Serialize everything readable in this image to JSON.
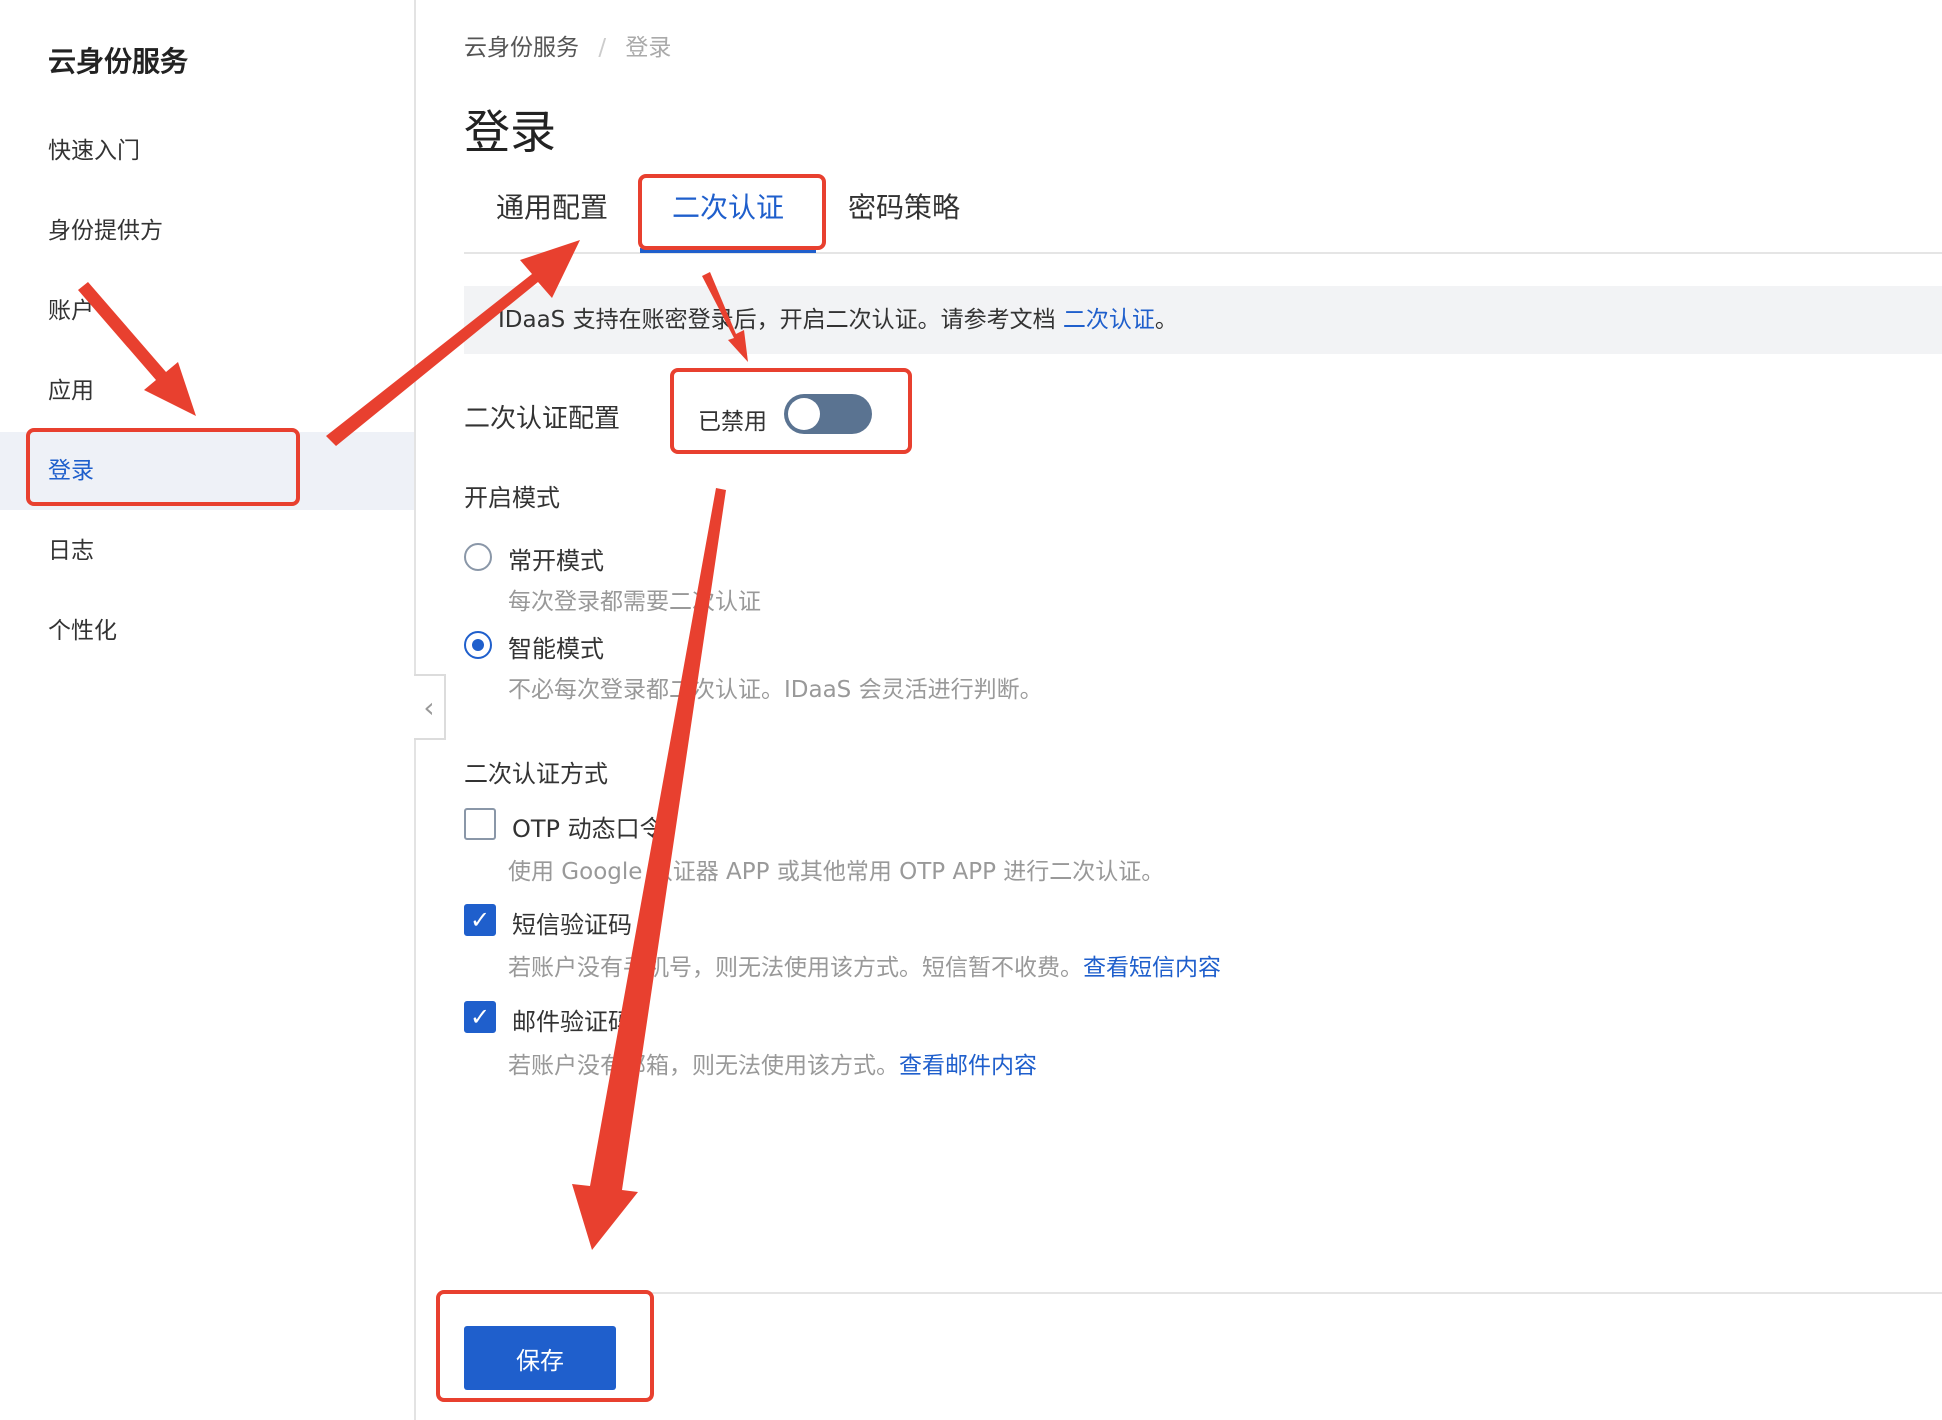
{
  "sidebar": {
    "title": "云身份服务",
    "items": [
      {
        "label": "快速入门"
      },
      {
        "label": "身份提供方"
      },
      {
        "label": "账户"
      },
      {
        "label": "应用"
      },
      {
        "label": "登录"
      },
      {
        "label": "日志"
      },
      {
        "label": "个性化"
      }
    ]
  },
  "breadcrumb": {
    "root": "云身份服务",
    "separator": "/",
    "current": "登录"
  },
  "page_title": "登录",
  "tabs": [
    {
      "label": "通用配置"
    },
    {
      "label": "二次认证"
    },
    {
      "label": "密码策略"
    }
  ],
  "notice": {
    "text": "IDaaS 支持在账密登录后，开启二次认证。请参考文档 ",
    "link": "二次认证",
    "end": "。"
  },
  "mfa_config": {
    "label": "二次认证配置",
    "status": "已禁用"
  },
  "mode": {
    "title": "开启模式",
    "options": [
      {
        "label": "常开模式",
        "desc": "每次登录都需要二次认证"
      },
      {
        "label": "智能模式",
        "desc": "不必每次登录都二次认证。IDaaS 会灵活进行判断。"
      }
    ]
  },
  "methods": {
    "title": "二次认证方式",
    "options": [
      {
        "label": "OTP 动态口令",
        "desc": "使用 Google 认证器 APP 或其他常用 OTP APP 进行二次认证。",
        "link": ""
      },
      {
        "label": "短信验证码",
        "desc": "若账户没有手机号，则无法使用该方式。短信暂不收费。",
        "link": "查看短信内容"
      },
      {
        "label": "邮件验证码",
        "desc": "若账户没有邮箱，则无法使用该方式。",
        "link": "查看邮件内容"
      }
    ]
  },
  "save_label": "保存",
  "icons": {
    "collapse": "chevron-left-icon",
    "check": "check-icon"
  },
  "colors": {
    "accent": "#1f5fcc",
    "annotation": "#e8402f",
    "toggle_off": "#5a7391"
  }
}
